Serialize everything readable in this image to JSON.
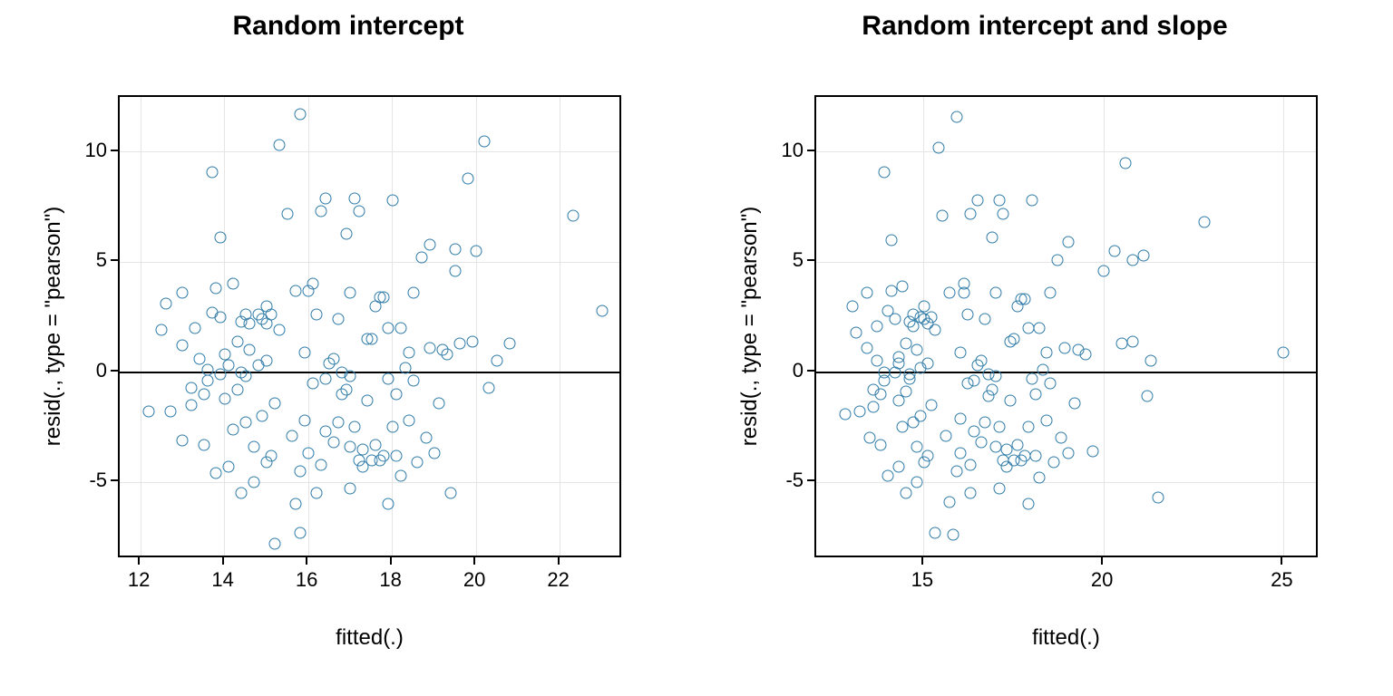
{
  "chart_data": [
    {
      "type": "scatter",
      "title": "Random intercept",
      "xlabel": "fitted(.)",
      "ylabel": "resid(., type = \"pearson\")",
      "xlim": [
        11.5,
        23.5
      ],
      "ylim": [
        -8.5,
        12.5
      ],
      "x_ticks": [
        12,
        14,
        16,
        18,
        20,
        22
      ],
      "y_ticks": [
        -5,
        0,
        5,
        10
      ],
      "zero_line": 0,
      "point_color": "#2e7ba8",
      "points": [
        [
          12.2,
          -1.8
        ],
        [
          12.5,
          1.9
        ],
        [
          12.6,
          3.1
        ],
        [
          12.7,
          -1.8
        ],
        [
          13.0,
          3.6
        ],
        [
          13.0,
          1.2
        ],
        [
          13.0,
          -3.1
        ],
        [
          13.2,
          -0.7
        ],
        [
          13.2,
          -1.5
        ],
        [
          13.3,
          2.0
        ],
        [
          13.4,
          0.6
        ],
        [
          13.5,
          -3.3
        ],
        [
          13.5,
          -1.0
        ],
        [
          13.6,
          0.1
        ],
        [
          13.6,
          -0.4
        ],
        [
          13.7,
          2.7
        ],
        [
          13.7,
          9.1
        ],
        [
          13.8,
          -4.6
        ],
        [
          13.8,
          3.8
        ],
        [
          13.9,
          6.1
        ],
        [
          13.9,
          2.5
        ],
        [
          13.9,
          -0.1
        ],
        [
          14.0,
          -1.2
        ],
        [
          14.0,
          0.8
        ],
        [
          14.1,
          0.3
        ],
        [
          14.1,
          -4.3
        ],
        [
          14.2,
          -2.6
        ],
        [
          14.2,
          4.0
        ],
        [
          14.3,
          1.4
        ],
        [
          14.3,
          -0.8
        ],
        [
          14.4,
          -5.5
        ],
        [
          14.4,
          0.0
        ],
        [
          14.4,
          2.3
        ],
        [
          14.5,
          -0.2
        ],
        [
          14.5,
          2.6
        ],
        [
          14.5,
          -2.3
        ],
        [
          14.6,
          2.2
        ],
        [
          14.6,
          1.0
        ],
        [
          14.7,
          -3.4
        ],
        [
          14.7,
          -5.0
        ],
        [
          14.8,
          2.6
        ],
        [
          14.8,
          0.3
        ],
        [
          14.9,
          -2.0
        ],
        [
          14.9,
          2.4
        ],
        [
          15.0,
          3.0
        ],
        [
          15.0,
          -4.1
        ],
        [
          15.0,
          0.5
        ],
        [
          15.0,
          2.2
        ],
        [
          15.1,
          -3.8
        ],
        [
          15.1,
          2.6
        ],
        [
          15.2,
          -1.4
        ],
        [
          15.2,
          -7.8
        ],
        [
          15.3,
          1.9
        ],
        [
          15.3,
          10.3
        ],
        [
          15.5,
          7.2
        ],
        [
          15.6,
          -2.9
        ],
        [
          15.7,
          -6.0
        ],
        [
          15.7,
          3.7
        ],
        [
          15.8,
          -7.3
        ],
        [
          15.8,
          11.7
        ],
        [
          15.8,
          -4.5
        ],
        [
          15.9,
          0.9
        ],
        [
          15.9,
          -2.2
        ],
        [
          16.0,
          -3.7
        ],
        [
          16.0,
          3.7
        ],
        [
          16.1,
          4.0
        ],
        [
          16.1,
          -0.5
        ],
        [
          16.2,
          2.6
        ],
        [
          16.2,
          -5.5
        ],
        [
          16.3,
          -4.2
        ],
        [
          16.3,
          7.3
        ],
        [
          16.4,
          -2.7
        ],
        [
          16.4,
          -0.3
        ],
        [
          16.4,
          7.9
        ],
        [
          16.5,
          0.4
        ],
        [
          16.6,
          0.6
        ],
        [
          16.6,
          -3.2
        ],
        [
          16.7,
          -2.3
        ],
        [
          16.7,
          2.4
        ],
        [
          16.8,
          -1.0
        ],
        [
          16.8,
          0.0
        ],
        [
          16.9,
          -0.8
        ],
        [
          16.9,
          6.3
        ],
        [
          17.0,
          3.6
        ],
        [
          17.0,
          -0.2
        ],
        [
          17.0,
          -3.4
        ],
        [
          17.0,
          -5.3
        ],
        [
          17.1,
          -2.5
        ],
        [
          17.1,
          7.9
        ],
        [
          17.2,
          7.3
        ],
        [
          17.2,
          -4.0
        ],
        [
          17.3,
          -4.3
        ],
        [
          17.3,
          -3.5
        ],
        [
          17.4,
          -1.3
        ],
        [
          17.4,
          1.5
        ],
        [
          17.5,
          1.5
        ],
        [
          17.5,
          -4.0
        ],
        [
          17.6,
          3.0
        ],
        [
          17.6,
          -3.3
        ],
        [
          17.7,
          -4.0
        ],
        [
          17.7,
          3.4
        ],
        [
          17.8,
          -3.8
        ],
        [
          17.8,
          3.4
        ],
        [
          17.9,
          -0.3
        ],
        [
          17.9,
          2.0
        ],
        [
          17.9,
          -6.0
        ],
        [
          18.0,
          -2.5
        ],
        [
          18.0,
          7.8
        ],
        [
          18.1,
          -3.8
        ],
        [
          18.1,
          -1.0
        ],
        [
          18.2,
          2.0
        ],
        [
          18.2,
          -4.7
        ],
        [
          18.3,
          0.2
        ],
        [
          18.4,
          -2.2
        ],
        [
          18.4,
          0.9
        ],
        [
          18.5,
          3.6
        ],
        [
          18.5,
          -0.4
        ],
        [
          18.6,
          -4.1
        ],
        [
          18.7,
          5.2
        ],
        [
          18.8,
          -3.0
        ],
        [
          18.9,
          1.1
        ],
        [
          18.9,
          5.8
        ],
        [
          19.0,
          -3.7
        ],
        [
          19.1,
          -1.4
        ],
        [
          19.2,
          1.0
        ],
        [
          19.3,
          0.8
        ],
        [
          19.4,
          -5.5
        ],
        [
          19.5,
          4.6
        ],
        [
          19.5,
          5.6
        ],
        [
          19.6,
          1.3
        ],
        [
          19.8,
          8.8
        ],
        [
          19.9,
          1.4
        ],
        [
          20.0,
          5.5
        ],
        [
          20.2,
          10.5
        ],
        [
          20.3,
          -0.7
        ],
        [
          20.5,
          0.5
        ],
        [
          20.8,
          1.3
        ],
        [
          22.3,
          7.1
        ],
        [
          23.0,
          2.8
        ]
      ]
    },
    {
      "type": "scatter",
      "title": "Random intercept and slope",
      "xlabel": "fitted(.)",
      "ylabel": "resid(., type = \"pearson\")",
      "xlim": [
        12.0,
        26.0
      ],
      "ylim": [
        -8.5,
        12.5
      ],
      "x_ticks": [
        15,
        20,
        25
      ],
      "y_ticks": [
        -5,
        0,
        5,
        10
      ],
      "zero_line": 0,
      "point_color": "#2e7ba8",
      "points": [
        [
          12.8,
          -1.9
        ],
        [
          13.0,
          3.0
        ],
        [
          13.1,
          1.8
        ],
        [
          13.2,
          -1.8
        ],
        [
          13.4,
          3.6
        ],
        [
          13.4,
          1.1
        ],
        [
          13.5,
          -3.0
        ],
        [
          13.6,
          -0.8
        ],
        [
          13.6,
          -1.6
        ],
        [
          13.7,
          2.1
        ],
        [
          13.7,
          0.5
        ],
        [
          13.8,
          -3.3
        ],
        [
          13.8,
          -1.0
        ],
        [
          13.9,
          0.0
        ],
        [
          13.9,
          -0.4
        ],
        [
          13.9,
          9.1
        ],
        [
          14.0,
          2.8
        ],
        [
          14.0,
          -4.7
        ],
        [
          14.1,
          3.7
        ],
        [
          14.1,
          6.0
        ],
        [
          14.2,
          2.4
        ],
        [
          14.2,
          0.0
        ],
        [
          14.3,
          -1.3
        ],
        [
          14.3,
          0.7
        ],
        [
          14.3,
          0.4
        ],
        [
          14.3,
          -4.3
        ],
        [
          14.4,
          -2.5
        ],
        [
          14.4,
          3.9
        ],
        [
          14.5,
          1.3
        ],
        [
          14.5,
          -0.9
        ],
        [
          14.5,
          -5.5
        ],
        [
          14.6,
          -0.1
        ],
        [
          14.6,
          2.3
        ],
        [
          14.6,
          -0.3
        ],
        [
          14.7,
          2.6
        ],
        [
          14.7,
          -2.3
        ],
        [
          14.7,
          2.1
        ],
        [
          14.8,
          1.0
        ],
        [
          14.8,
          -3.4
        ],
        [
          14.8,
          -5.0
        ],
        [
          14.9,
          2.5
        ],
        [
          14.9,
          0.2
        ],
        [
          14.9,
          -2.0
        ],
        [
          15.0,
          2.4
        ],
        [
          15.0,
          3.0
        ],
        [
          15.0,
          -4.1
        ],
        [
          15.1,
          0.4
        ],
        [
          15.1,
          2.2
        ],
        [
          15.1,
          -3.8
        ],
        [
          15.2,
          2.5
        ],
        [
          15.2,
          -1.5
        ],
        [
          15.3,
          -7.3
        ],
        [
          15.3,
          1.9
        ],
        [
          15.4,
          10.2
        ],
        [
          15.5,
          7.1
        ],
        [
          15.6,
          -2.9
        ],
        [
          15.7,
          -5.9
        ],
        [
          15.7,
          3.6
        ],
        [
          15.8,
          -7.4
        ],
        [
          15.9,
          11.6
        ],
        [
          15.9,
          -4.5
        ],
        [
          16.0,
          0.9
        ],
        [
          16.0,
          -2.1
        ],
        [
          16.0,
          -3.7
        ],
        [
          16.1,
          3.6
        ],
        [
          16.1,
          4.0
        ],
        [
          16.2,
          -0.5
        ],
        [
          16.2,
          2.6
        ],
        [
          16.3,
          -5.5
        ],
        [
          16.3,
          -4.2
        ],
        [
          16.3,
          7.2
        ],
        [
          16.4,
          -2.7
        ],
        [
          16.4,
          -0.4
        ],
        [
          16.5,
          7.8
        ],
        [
          16.5,
          0.3
        ],
        [
          16.6,
          0.5
        ],
        [
          16.6,
          -3.2
        ],
        [
          16.7,
          -2.3
        ],
        [
          16.7,
          2.4
        ],
        [
          16.8,
          -1.1
        ],
        [
          16.8,
          -0.1
        ],
        [
          16.9,
          -0.8
        ],
        [
          16.9,
          6.1
        ],
        [
          17.0,
          3.6
        ],
        [
          17.0,
          -0.2
        ],
        [
          17.0,
          -3.4
        ],
        [
          17.1,
          -5.3
        ],
        [
          17.1,
          -2.5
        ],
        [
          17.1,
          7.8
        ],
        [
          17.2,
          7.2
        ],
        [
          17.2,
          -4.0
        ],
        [
          17.3,
          -4.3
        ],
        [
          17.3,
          -3.5
        ],
        [
          17.4,
          -1.3
        ],
        [
          17.4,
          1.4
        ],
        [
          17.5,
          1.5
        ],
        [
          17.5,
          -4.0
        ],
        [
          17.6,
          3.0
        ],
        [
          17.6,
          -3.3
        ],
        [
          17.7,
          -4.0
        ],
        [
          17.7,
          3.3
        ],
        [
          17.8,
          -3.8
        ],
        [
          17.8,
          3.3
        ],
        [
          17.9,
          -2.5
        ],
        [
          17.9,
          2.0
        ],
        [
          17.9,
          -6.0
        ],
        [
          18.0,
          -0.3
        ],
        [
          18.0,
          7.8
        ],
        [
          18.1,
          -3.8
        ],
        [
          18.1,
          -1.0
        ],
        [
          18.2,
          2.0
        ],
        [
          18.2,
          -4.8
        ],
        [
          18.3,
          0.1
        ],
        [
          18.4,
          -2.2
        ],
        [
          18.4,
          0.9
        ],
        [
          18.5,
          3.6
        ],
        [
          18.5,
          -0.5
        ],
        [
          18.6,
          -4.1
        ],
        [
          18.7,
          5.1
        ],
        [
          18.8,
          -3.0
        ],
        [
          18.9,
          1.1
        ],
        [
          19.0,
          5.9
        ],
        [
          19.0,
          -3.7
        ],
        [
          19.2,
          -1.4
        ],
        [
          19.3,
          1.0
        ],
        [
          19.5,
          0.8
        ],
        [
          19.7,
          -3.6
        ],
        [
          20.0,
          4.6
        ],
        [
          20.3,
          5.5
        ],
        [
          20.5,
          1.3
        ],
        [
          20.6,
          9.5
        ],
        [
          20.8,
          1.4
        ],
        [
          20.8,
          5.1
        ],
        [
          21.1,
          5.3
        ],
        [
          21.2,
          -1.1
        ],
        [
          21.3,
          0.5
        ],
        [
          21.5,
          -5.7
        ],
        [
          22.8,
          6.8
        ],
        [
          25.0,
          0.9
        ]
      ]
    }
  ]
}
